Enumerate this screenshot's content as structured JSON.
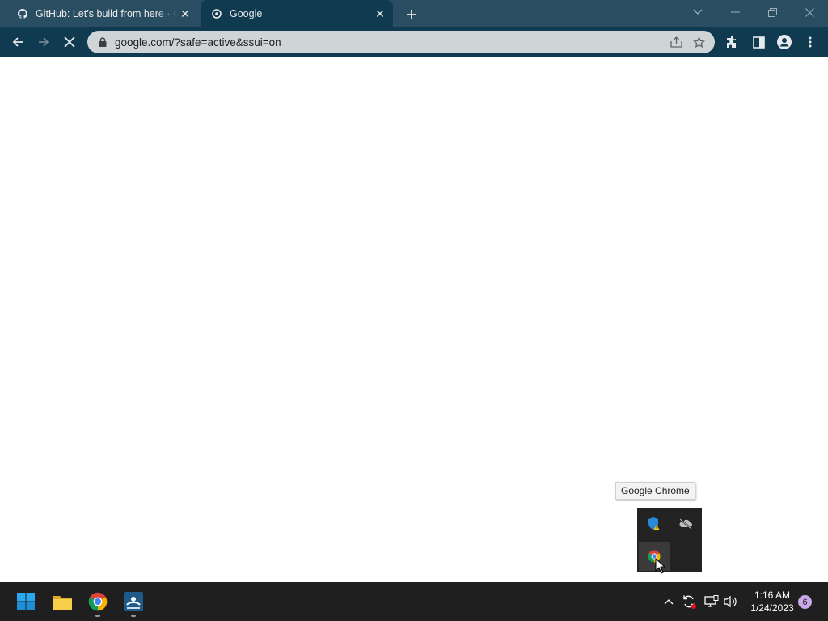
{
  "browser": {
    "tabs": [
      {
        "title": "GitHub: Let’s build from here · GitHub",
        "favicon": "github-icon",
        "active": false
      },
      {
        "title": "Google",
        "favicon": "google-icon",
        "active": true
      }
    ],
    "new_tab_icon": "plus-icon",
    "window_controls": [
      "tab-search-icon",
      "minimize-icon",
      "restore-icon",
      "close-icon"
    ]
  },
  "toolbar": {
    "url": "google.com/?safe=active&ssui=on",
    "status": "loading",
    "icons": [
      "back-icon",
      "forward-icon",
      "stop-icon",
      "lock-icon",
      "share-icon",
      "star-icon",
      "extensions-icon",
      "side-panel-icon",
      "profile-icon",
      "menu-icon"
    ]
  },
  "tray_flyout": {
    "tooltip": "Google Chrome",
    "items": [
      "windows-security-warning-icon",
      "onedrive-offline-icon",
      "chrome-icon"
    ]
  },
  "taskbar": {
    "apps": [
      "windows-start-icon",
      "file-explorer-icon",
      "chrome-icon",
      "app-icon"
    ],
    "time": "1:16 AM",
    "date": "1/24/2023",
    "notification_count": "6"
  },
  "colors": {
    "tab_strip": "#294d61",
    "toolbar": "#0f3a4f",
    "omnibox": "#cfd4d7",
    "taskbar": "#1f1f1f"
  }
}
